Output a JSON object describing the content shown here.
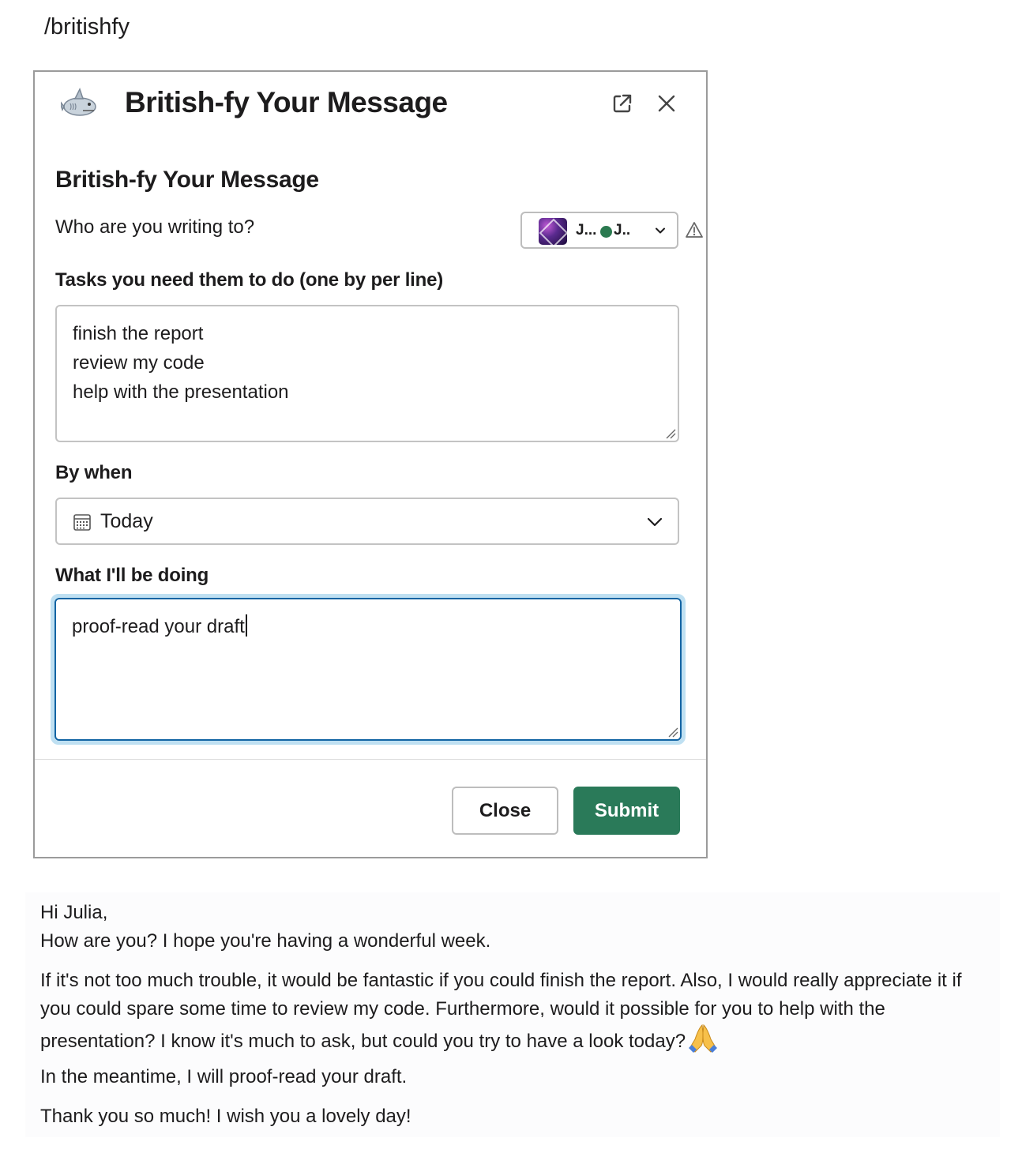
{
  "command": "/britishfy",
  "modal": {
    "title": "British-fy Your Message",
    "section_title": "British-fy Your Message",
    "who_label": "Who are you writing to?",
    "recipient": {
      "name1": "J...",
      "name2": "J..",
      "presence_color": "#2b7a50"
    },
    "tasks_label": "Tasks you need them to do (one by per line)",
    "tasks_lines": [
      "finish the report",
      "review my code",
      "help with the presentation"
    ],
    "by_when_label": "By when",
    "by_when_value": "Today",
    "doing_label": "What I'll be doing",
    "doing_value": "proof-read your draft",
    "close_label": "Close",
    "submit_label": "Submit",
    "submit_color": "#2a7a59",
    "focus_color": "#1264a3"
  },
  "output": {
    "greeting": "Hi Julia,",
    "line2": "How are you? I hope you're having a wonderful week.",
    "para2": "If it's not too much trouble, it would be fantastic if you could finish the report. Also, I would really appreciate it if you could spare some time to review my code. Furthermore, would it possible for you to help with the presentation? I know it's much to ask, but could you try to have a look today?",
    "para2_emoji": "folded-hands-emoji",
    "para3": "In the meantime, I will proof-read your draft.",
    "para4": "Thank you so much! I wish you a lovely day!"
  }
}
